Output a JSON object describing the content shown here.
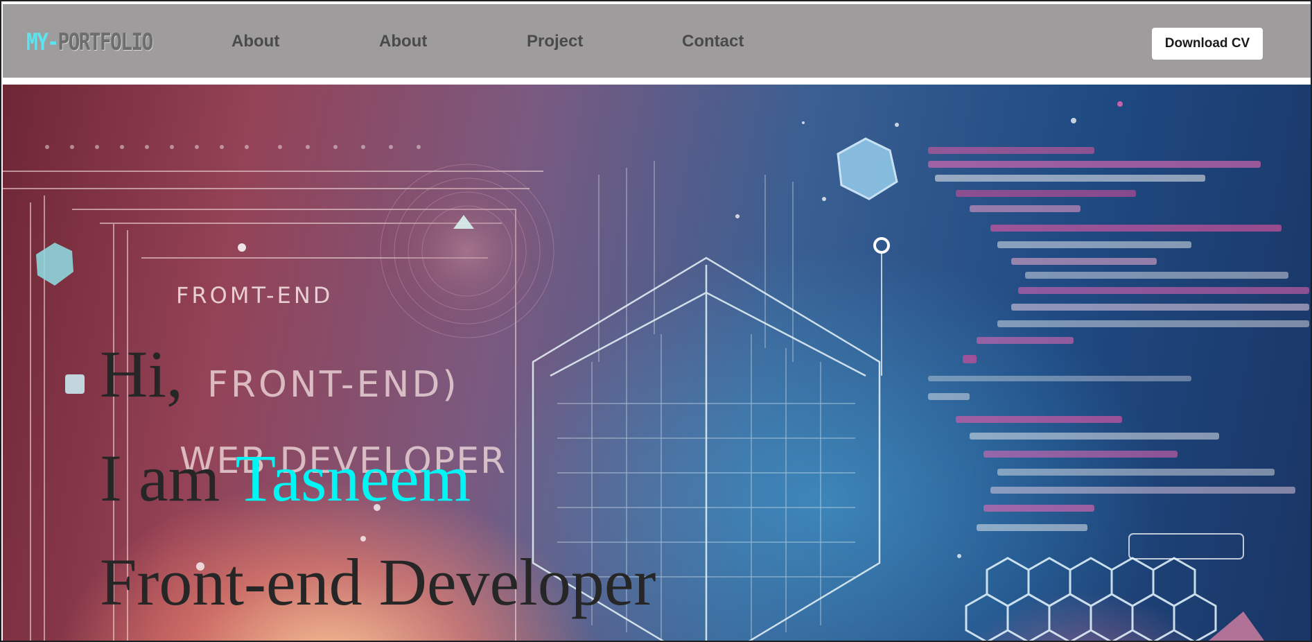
{
  "brand": {
    "logo_part1": "MY-",
    "logo_part2": "PORTFOLIO"
  },
  "nav": {
    "links": [
      {
        "label": "About"
      },
      {
        "label": "About"
      },
      {
        "label": "Project"
      },
      {
        "label": "Contact"
      }
    ],
    "cta_label": "Download CV"
  },
  "hero": {
    "line1": "Hi,",
    "line2_prefix": "I am",
    "name": "Tasneem",
    "line3": "Front-end Developer",
    "background_image": {
      "art_text_1": "FROMT-END",
      "art_text_2": "FRONT-END)",
      "art_text_3": "WEB DEVELOPER"
    }
  },
  "colors": {
    "navbar_bg": "#9e9c9c",
    "accent_cyan": "#00f5f5",
    "logo_cyan": "#5de3f0",
    "text_dark": "#262626"
  }
}
